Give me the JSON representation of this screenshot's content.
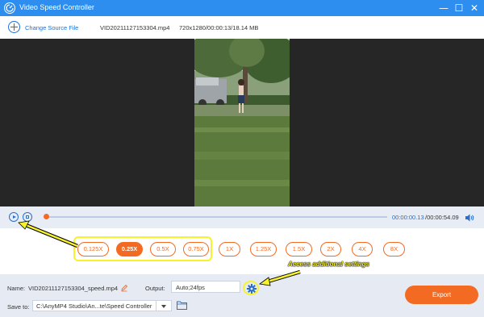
{
  "window": {
    "title": "Video Speed Controller",
    "minimize_glyph": "—",
    "maximize_glyph": "☐",
    "close_glyph": "✕"
  },
  "filebar": {
    "change_source_label": "Change Source File",
    "file_name": "VID20211127153304.mp4",
    "file_meta": "720x1280/00:00:13/18.14 MB"
  },
  "playback": {
    "current_time": "00:00:00.13",
    "total_time": "/00:00:54.09",
    "progress": 0.0
  },
  "speed": {
    "options": [
      "0.125X",
      "0.25X",
      "0.5X",
      "0.75X",
      "1X",
      "1.25X",
      "1.5X",
      "2X",
      "4X",
      "8X"
    ],
    "selected": "0.25X"
  },
  "annotation": {
    "text": "Access additional settings"
  },
  "output": {
    "name_label": "Name:",
    "name_value": "VID20211127153304_speed.mp4",
    "output_label": "Output:",
    "output_value": "Auto;24fps",
    "save_label": "Save to:",
    "save_path": "C:\\AnyMP4 Studio\\An...te\\Speed Controller",
    "export_label": "Export"
  },
  "colors": {
    "titlebar": "#2d8ef0",
    "accent": "#f36b22",
    "highlight": "#f6f22b",
    "link": "#1d6fd0"
  }
}
